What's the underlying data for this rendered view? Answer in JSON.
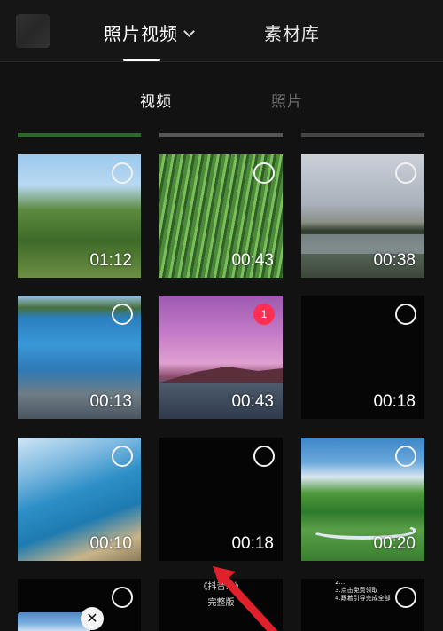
{
  "header": {
    "tab_active": "照片视频",
    "tab_library": "素材库"
  },
  "subtabs": {
    "video": "视频",
    "photo": "照片"
  },
  "tiles": [
    {
      "duration": "01:12",
      "selected": false
    },
    {
      "duration": "00:43",
      "selected": false
    },
    {
      "duration": "00:38",
      "selected": false
    },
    {
      "duration": "00:13",
      "selected": false
    },
    {
      "duration": "00:43",
      "selected": true,
      "order": "1"
    },
    {
      "duration": "00:18",
      "selected": false
    },
    {
      "duration": "00:10",
      "selected": false
    },
    {
      "duration": "00:18",
      "selected": false
    },
    {
      "duration": "00:20",
      "selected": false
    }
  ],
  "partial_tiles": {
    "p2_caption_top": "《抖音…》",
    "p2_caption_bottom": "完整版",
    "p3_lines": [
      "2.…",
      "3.点击免费领取",
      "4.跟着引导完成全部"
    ]
  },
  "colors": {
    "accent_selected": "#ff2e53",
    "background": "#121212"
  },
  "icons": {
    "close": "close-icon",
    "dropdown": "chevron-down-icon"
  }
}
